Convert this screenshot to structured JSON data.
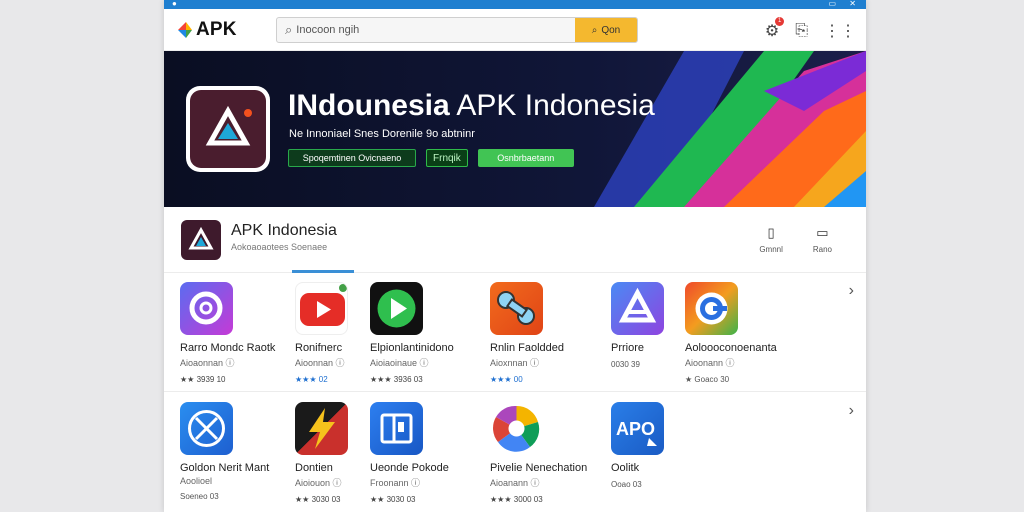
{
  "window": {
    "titlebar_icons": [
      "window-icon",
      "minimize-icon",
      "close-icon"
    ]
  },
  "header": {
    "logo_text": "APK",
    "search_placeholder": "Inocoon ngih",
    "search_button_label": "Qon",
    "notification_count": "1"
  },
  "banner": {
    "title_bold": "INdounesia",
    "title_rest": " APK Indonesia",
    "subtitle": "Ne Innoniael Snes Dorenile 9o abtninr",
    "tags": [
      "Spoqemtinen Ovicnaeno",
      "Frnqik",
      "Osnbrbaetann"
    ]
  },
  "app_header": {
    "title": "APK Indonesia",
    "subtitle": "Aokoaoaotees Soenaee",
    "actions": [
      {
        "icon": "bookmark-icon",
        "label": "Gmnnl"
      },
      {
        "icon": "message-icon",
        "label": "Rano"
      }
    ]
  },
  "rows": [
    {
      "apps": [
        {
          "name": "Rarro Mondc Raotk",
          "developer": "Aioaonnan ⓘ",
          "rating": "★★ 3939 10",
          "icon": "purple-ring-icon"
        },
        {
          "name": "Ronifnerc",
          "developer": "Aioonnan ⓘ",
          "rating": "★★★ 02",
          "icon": "youtube-icon"
        },
        {
          "name": "Elpionlantinidono",
          "developer": "Aioiaoinaue ⓘ",
          "rating": "★★★ 3936 03",
          "icon": "play-icon"
        },
        {
          "name": "Rnlin Faoldded",
          "developer": "Aioxnnan ⓘ",
          "rating": "★★★ 00",
          "icon": "puzzle-icon"
        },
        {
          "name": "Prriore",
          "developer": "",
          "rating": "0030 39",
          "icon": "app-store-icon"
        },
        {
          "name": "Aoloooconoenanta",
          "developer": "Aioonann ⓘ",
          "rating": "★ Goaco 30",
          "icon": "chrome-icon"
        }
      ]
    },
    {
      "apps": [
        {
          "name": "Goldon Nerit Mant",
          "developer": "Aoolioel",
          "rating": "Soeneo 03",
          "icon": "safari-icon"
        },
        {
          "name": "Dontien",
          "developer": "Aioiouon ⓘ",
          "rating": "★★ 3030 03",
          "icon": "flash-icon"
        },
        {
          "name": "Ueonde Pokode",
          "developer": "Froonann ⓘ",
          "rating": "★★ 3030 03",
          "icon": "sidebar-icon"
        },
        {
          "name": "Pivelie Nenechation",
          "developer": "Aioanann ⓘ",
          "rating": "★★★ 3000 03",
          "icon": "photos-icon"
        },
        {
          "name": "Oolitk",
          "developer": "",
          "rating": "Ooao 03",
          "icon": "apk-icon"
        }
      ]
    }
  ]
}
